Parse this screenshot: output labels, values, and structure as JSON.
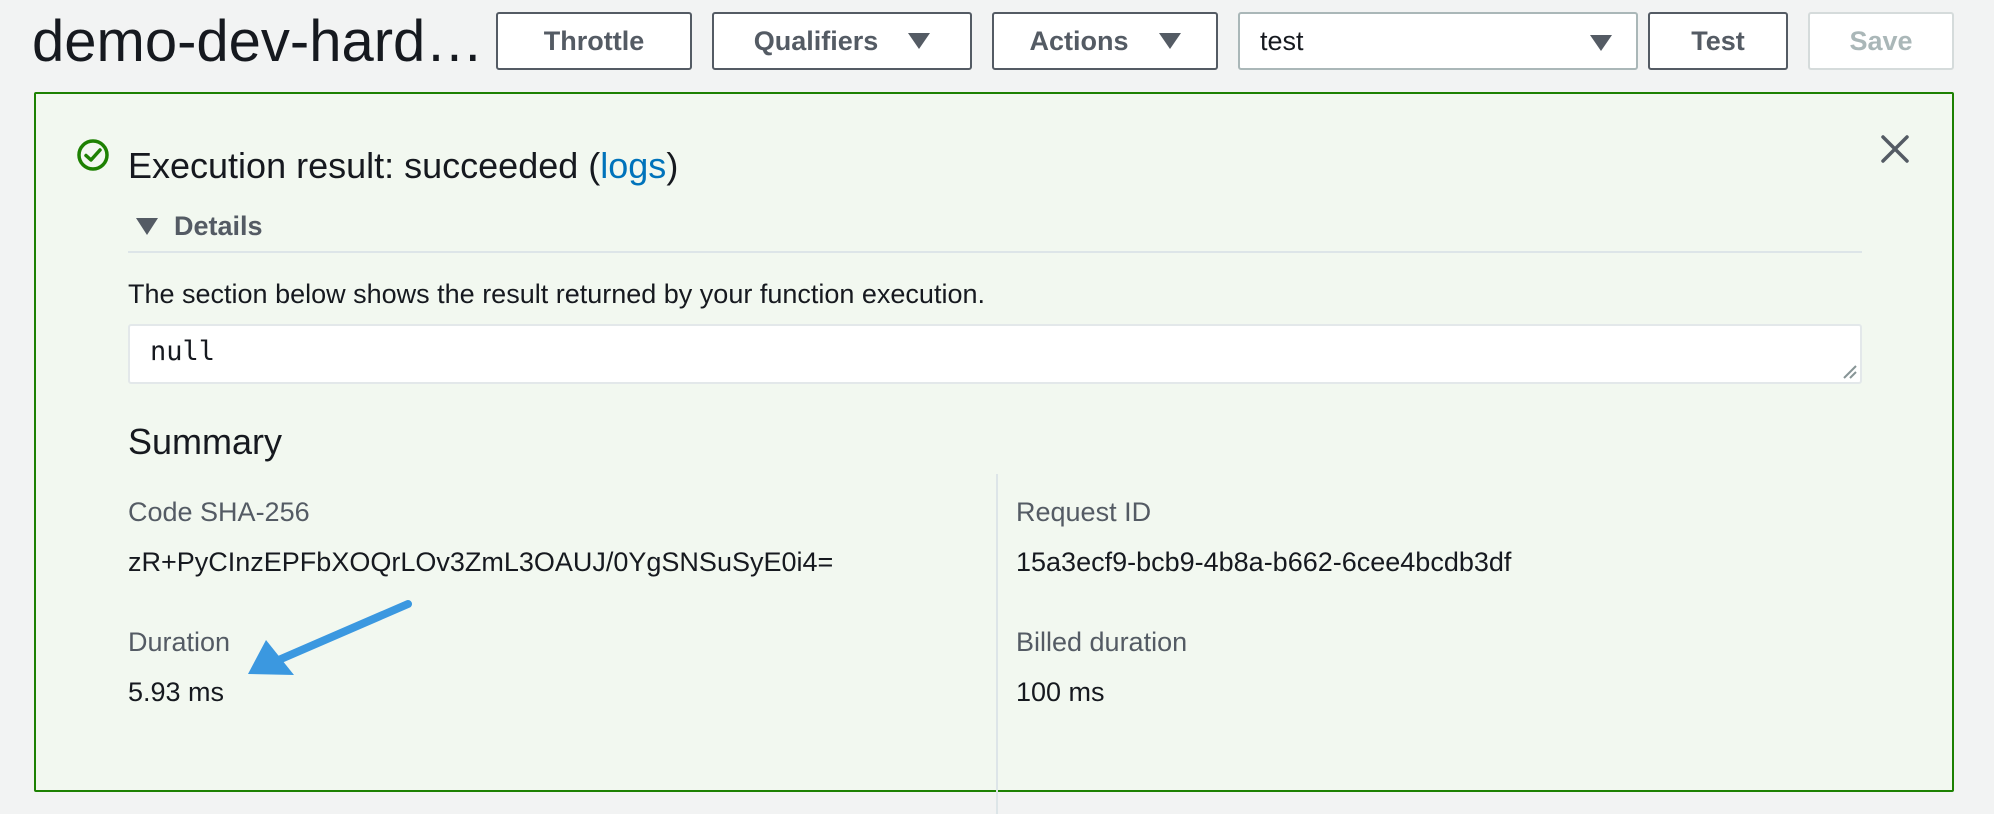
{
  "header": {
    "function_name": "demo-dev-hard…",
    "buttons": {
      "throttle": "Throttle",
      "qualifiers": "Qualifiers",
      "actions": "Actions",
      "test": "Test",
      "save": "Save"
    },
    "test_event_select": {
      "value": "test"
    }
  },
  "result": {
    "heading_prefix": "Execution result: succeeded (",
    "logs_link": "logs",
    "heading_suffix": ")",
    "status_color": "#1d8102",
    "details_label": "Details",
    "description": "The section below shows the result returned by your function execution.",
    "output": "null",
    "summary": {
      "title": "Summary",
      "code_sha_label": "Code SHA-256",
      "code_sha_value": "zR+PyCInzEPFbXOQrLOv3ZmL3OAUJ/0YgSNSuSyE0i4=",
      "request_id_label": "Request ID",
      "request_id_value": "15a3ecf9-bcb9-4b8a-b662-6cee4bcdb3df",
      "duration_label": "Duration",
      "duration_value": "5.93 ms",
      "billed_duration_label": "Billed duration",
      "billed_duration_value": "100 ms"
    }
  },
  "icons": {
    "status": "check-circle-icon",
    "close": "close-icon",
    "annotation": "arrow-annotation-icon"
  }
}
